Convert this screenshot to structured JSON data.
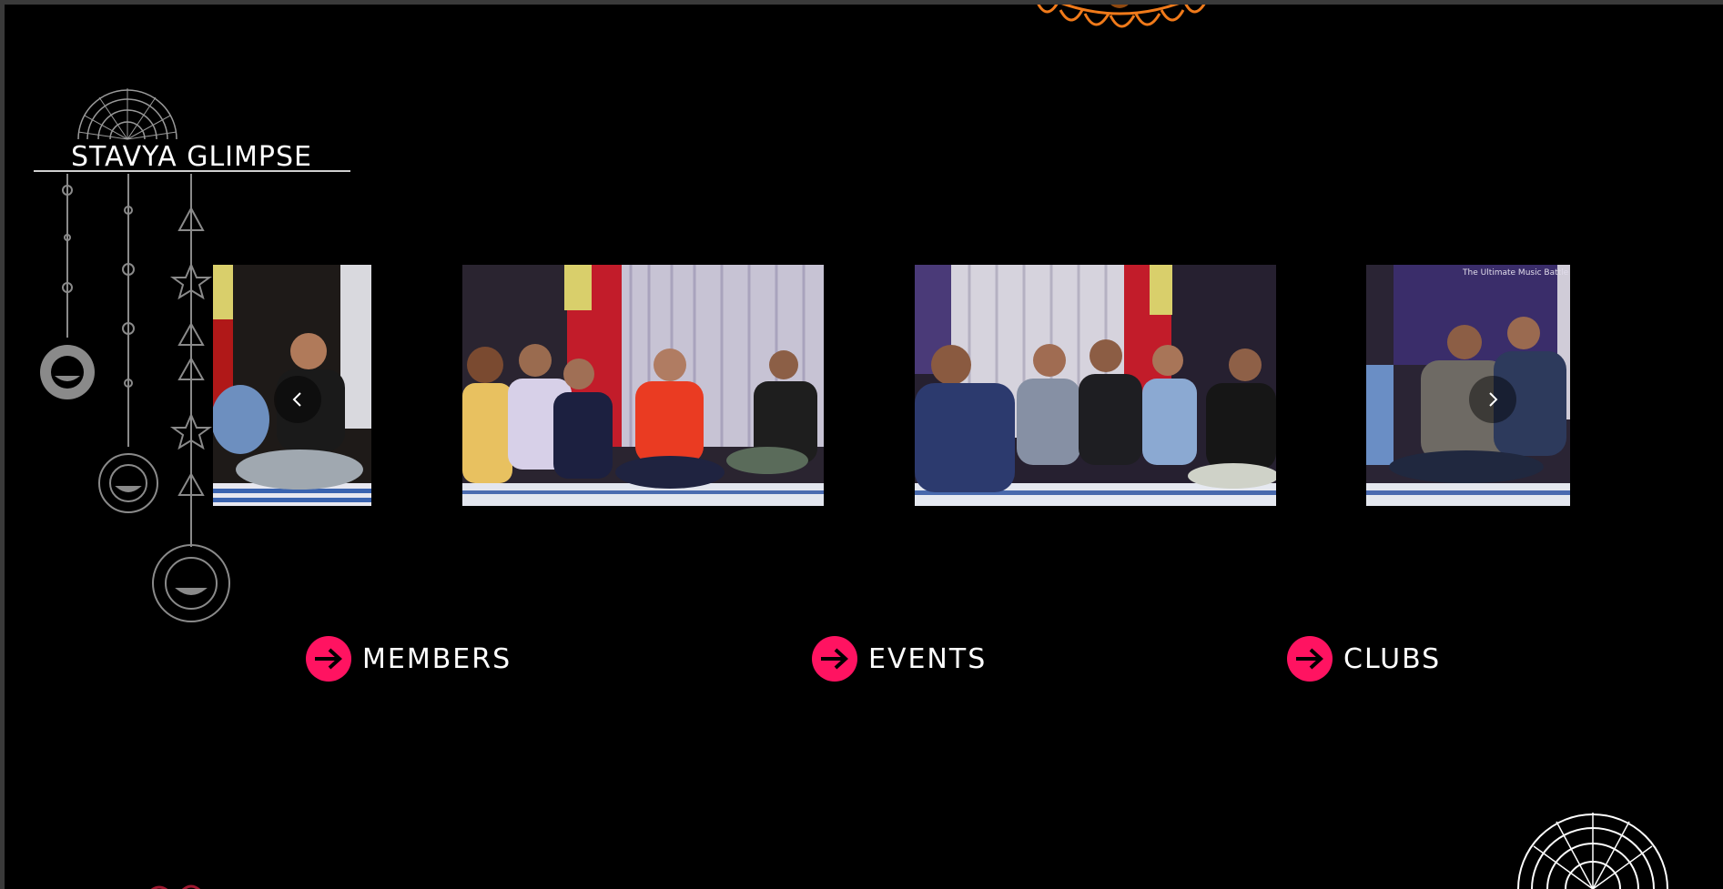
{
  "section": {
    "title": "STAVYA GLIMPSE"
  },
  "carousel": {
    "slides": [
      {
        "alt": "photo-1"
      },
      {
        "alt": "photo-2"
      },
      {
        "alt": "photo-3"
      },
      {
        "alt": "photo-4"
      }
    ],
    "slide4_banner_text": "The Ultimate Music Battle",
    "prev_icon": "chevron-left-icon",
    "next_icon": "chevron-right-icon"
  },
  "links": [
    {
      "label": "MEMBERS",
      "icon": "arrow-right-icon"
    },
    {
      "label": "EVENTS",
      "icon": "arrow-right-icon"
    },
    {
      "label": "CLUBS",
      "icon": "arrow-right-icon"
    }
  ],
  "colors": {
    "background": "#000000",
    "accent": "#ff1361",
    "mandala_orange": "#f07a1a",
    "ornament_gray": "#9a9a9a"
  }
}
